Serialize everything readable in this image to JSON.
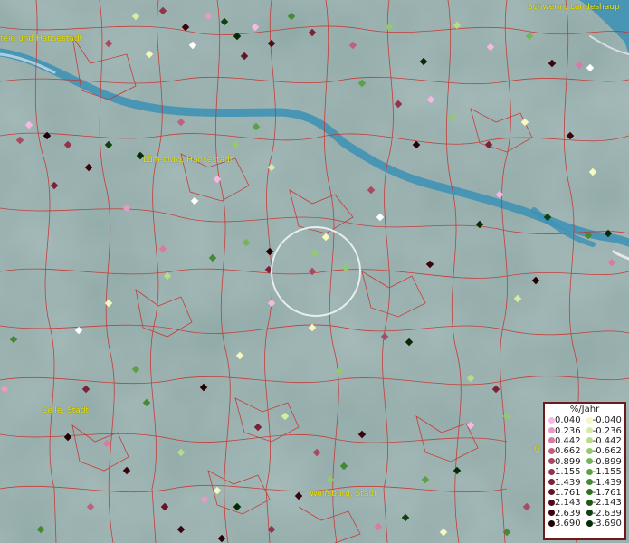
{
  "map": {
    "background": "#8fa8a6",
    "river_color": "#3f92b5",
    "border_color": "#c8322e",
    "places": [
      {
        "id": "schwerin",
        "label": "Schwerin, Landeshaup"
      },
      {
        "id": "hamburg",
        "label": "reie und Hansestadt"
      },
      {
        "id": "lueneburg",
        "label": "Lüneburg, Hansestadt"
      },
      {
        "id": "celle",
        "label": "Celle, Stadt"
      },
      {
        "id": "wolfsburg",
        "label": "Wolfsburg, Stadt"
      },
      {
        "id": "edge-g",
        "label": "G"
      }
    ]
  },
  "legend": {
    "title": "%/Jahr",
    "positive": [
      {
        "value": "0.040",
        "color": "#f6b8e0"
      },
      {
        "value": "0.236",
        "color": "#e89ac4"
      },
      {
        "value": "0.442",
        "color": "#d97aa6"
      },
      {
        "value": "0.662",
        "color": "#c0607f"
      },
      {
        "value": "0.899",
        "color": "#a84a62"
      },
      {
        "value": "1.155",
        "color": "#92344a"
      },
      {
        "value": "1.439",
        "color": "#7c2236"
      },
      {
        "value": "1.761",
        "color": "#661426"
      },
      {
        "value": "2.143",
        "color": "#500a18"
      },
      {
        "value": "2.639",
        "color": "#3a040c"
      },
      {
        "value": "3.690",
        "color": "#220004"
      }
    ],
    "negative": [
      {
        "value": "-0.040",
        "color": "#f6f8c0"
      },
      {
        "value": "-0.236",
        "color": "#d6eca4"
      },
      {
        "value": "-0.442",
        "color": "#b6dc8a"
      },
      {
        "value": "-0.662",
        "color": "#94c870"
      },
      {
        "value": "-0.899",
        "color": "#76b45a"
      },
      {
        "value": "-1.155",
        "color": "#5ca046"
      },
      {
        "value": "-1.439",
        "color": "#448a34"
      },
      {
        "value": "-1.761",
        "color": "#307224"
      },
      {
        "value": "-2.143",
        "color": "#1e5a16"
      },
      {
        "value": "-2.639",
        "color": "#10420c"
      },
      {
        "value": "-3.690",
        "color": "#052a04"
      }
    ]
  }
}
